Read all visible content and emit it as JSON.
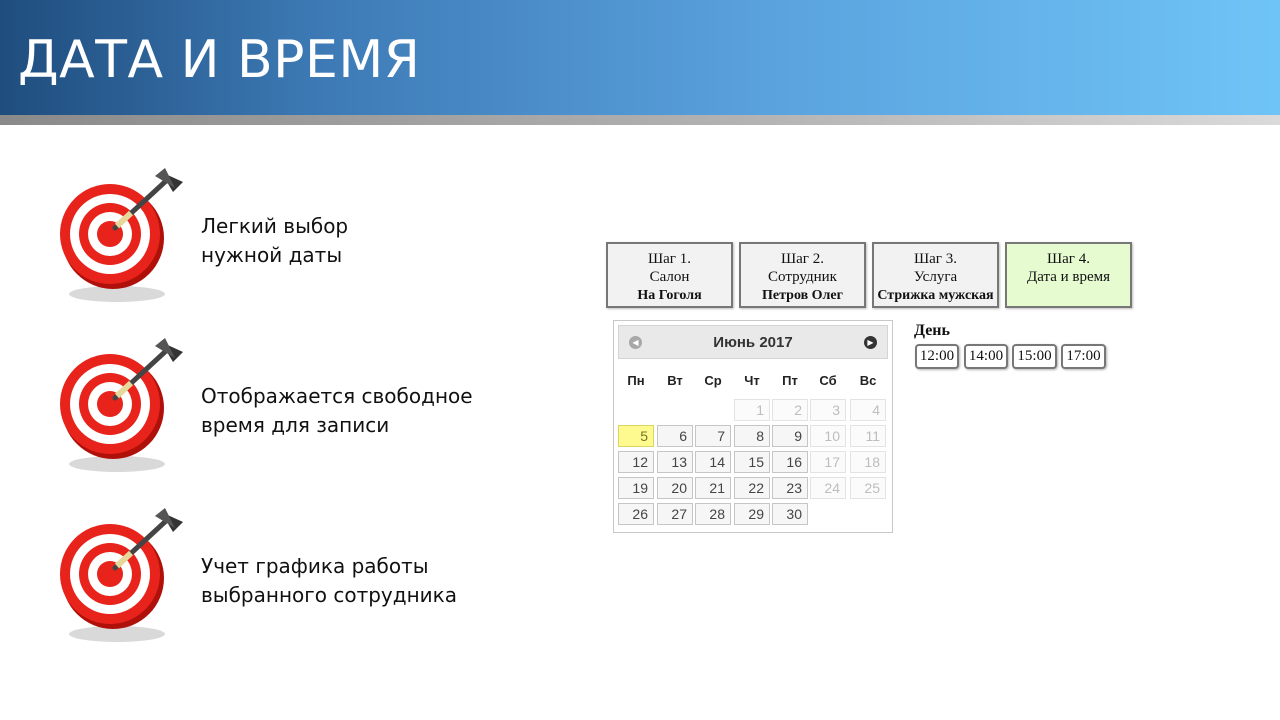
{
  "header": {
    "title": "ДАТА И ВРЕМЯ"
  },
  "features": [
    {
      "line1": "Легкий выбор",
      "line2": "нужной даты"
    },
    {
      "line1": "Отображается свободное",
      "line2": "время для записи"
    },
    {
      "line1": "Учет графика работы",
      "line2": "выбранного сотрудника"
    }
  ],
  "steps": [
    {
      "title": "Шаг 1.",
      "label": "Салон",
      "value": "На Гоголя"
    },
    {
      "title": "Шаг 2.",
      "label": "Сотрудник",
      "value": "Петров Олег"
    },
    {
      "title": "Шаг 3.",
      "label": "Услуга",
      "value": "Стрижка мужская"
    },
    {
      "title": "Шаг 4.",
      "label": "Дата и время",
      "value": ""
    }
  ],
  "calendar": {
    "month_title": "Июнь 2017",
    "weekdays": [
      "Пн",
      "Вт",
      "Ср",
      "Чт",
      "Пт",
      "Сб",
      "Вс"
    ],
    "days": [
      "1",
      "2",
      "3",
      "4",
      "5",
      "6",
      "7",
      "8",
      "9",
      "10",
      "11",
      "12",
      "13",
      "14",
      "15",
      "16",
      "17",
      "18",
      "19",
      "20",
      "21",
      "22",
      "23",
      "24",
      "25",
      "26",
      "27",
      "28",
      "29",
      "30"
    ],
    "selected_day": "5"
  },
  "times": {
    "label": "День",
    "slots": [
      "12:00",
      "14:00",
      "15:00",
      "17:00"
    ]
  },
  "colors": {
    "active_step": "#e6fbd0",
    "today": "#fffa90"
  }
}
